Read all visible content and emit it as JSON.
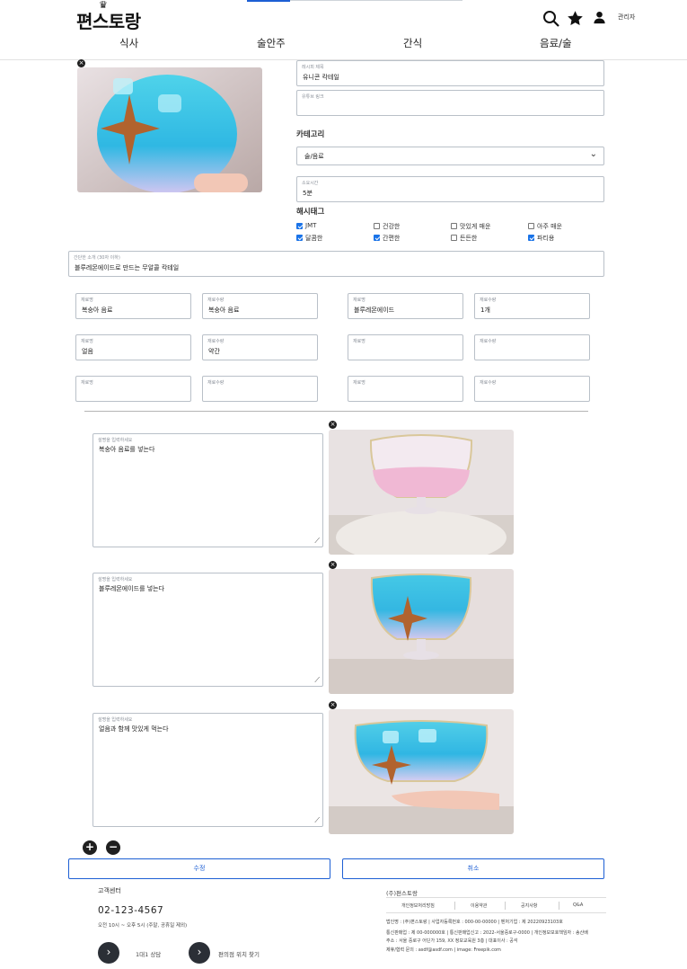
{
  "header": {
    "logo": "편스토랑",
    "admin_label": "관리자",
    "nav": [
      "식사",
      "술안주",
      "간식",
      "음료/술"
    ]
  },
  "form": {
    "title": {
      "label": "레시피 제목",
      "value": "유니콘 칵테일"
    },
    "youtube": {
      "label": "유튜브 링크",
      "value": ""
    },
    "category_heading": "카테고리",
    "category_value": "술/음료",
    "time": {
      "label": "소요시간",
      "value": "5분"
    },
    "hashtag_heading": "해시태그",
    "hashtags": [
      {
        "label": "JMT",
        "checked": true
      },
      {
        "label": "건강한",
        "checked": false
      },
      {
        "label": "맛있게 매운",
        "checked": false
      },
      {
        "label": "아주 매운",
        "checked": false
      },
      {
        "label": "달콤한",
        "checked": true
      },
      {
        "label": "간편한",
        "checked": true
      },
      {
        "label": "든든한",
        "checked": false
      },
      {
        "label": "파티용",
        "checked": true
      }
    ],
    "summary": {
      "label": "간단한 소개 (30자 이하)",
      "value": "블루레몬에이드로 만드는 무알콜 칵테일"
    },
    "ingredient_label": "재료명",
    "amount_label": "재료수량",
    "ingredients": [
      {
        "name": "복숭아 음료",
        "amount": "복숭아 음료"
      },
      {
        "name": "블루레몬에이드",
        "amount": "1개"
      },
      {
        "name": "얼음",
        "amount": "약간"
      },
      {
        "name": "",
        "amount": ""
      },
      {
        "name": "",
        "amount": ""
      },
      {
        "name": "",
        "amount": ""
      }
    ],
    "steps_label": "설명을 입력하세요",
    "steps": [
      "복숭아 음료를 넣는다",
      "블루레몬에이드를 넣는다",
      "얼음과 함께 맛있게 먹는다"
    ],
    "submit_label": "수정",
    "cancel_label": "취소"
  },
  "footer": {
    "cs_title": "고객센터",
    "phone": "02-123-4567",
    "hours": "오전 10시 ~ 오후 5시 (주말, 공휴일 제외)",
    "chat_label": "1대1 상담",
    "store_label": "편의점 위치 찾기",
    "company": "(주)편스토랑",
    "links": [
      "개인정보처리방침",
      "이용약관",
      "공지사항",
      "Q&A"
    ],
    "info1": "법인명 : (주)편스토랑 | 사업자등록번호 : 000-00-00000 | 벤처기업 : 제 20220923103호",
    "info2": "통신판매업 : 제 00-000000호 | 통신판매업신고 : 2022-서울중로구-0000 | 개인정보보호책임자 : 송산배",
    "info3": "주소 : 서울 중로구 어딘가 159, XX 정보교육원 3층 | 대표이사 : 공석",
    "info4": "제휴/협력 문의 : asdf@asdf.com | image: Freepik.com"
  },
  "colors": {
    "accent": "#1d5fd4",
    "check": "#1a73e8",
    "dark": "#1f1f1f"
  }
}
